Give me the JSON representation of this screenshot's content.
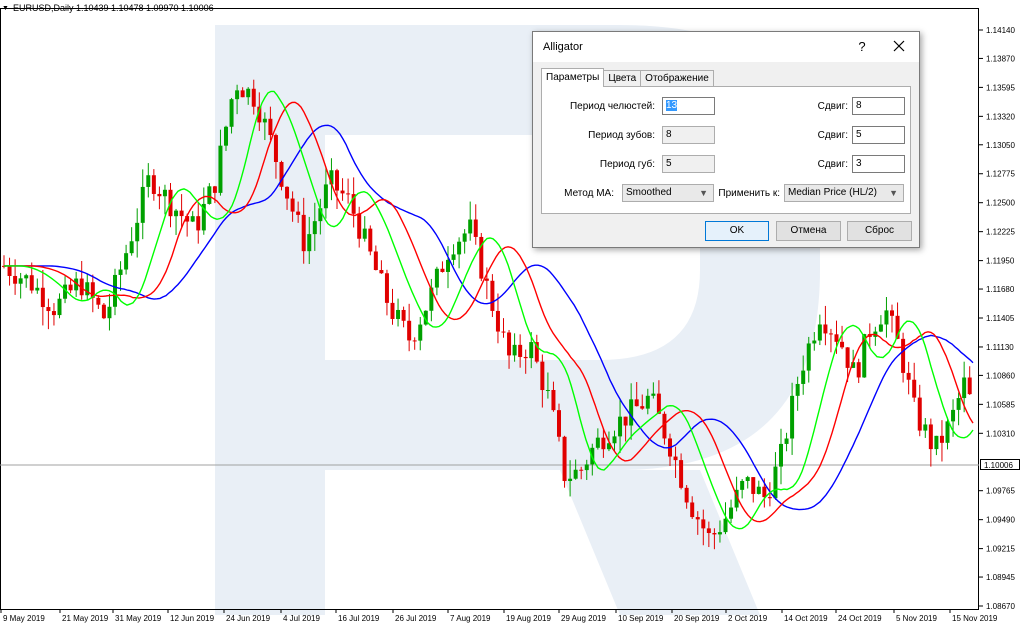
{
  "chart": {
    "symbol_line": "EURUSD,Daily  1.10439 1.10478 1.09970 1.10006",
    "price_levels": [
      "1.14140",
      "1.13870",
      "1.13595",
      "1.13320",
      "1.13050",
      "1.12775",
      "1.12500",
      "1.12225",
      "1.11950",
      "1.11680",
      "1.11405",
      "1.11130",
      "1.10860",
      "1.10585",
      "1.10310",
      "1.10006",
      "1.09765",
      "1.09490",
      "1.09215",
      "1.08945",
      "1.08670"
    ],
    "current_price": "1.10006",
    "date_labels": [
      "9 May 2019",
      "21 May 2019",
      "31 May 2019",
      "12 Jun 2019",
      "24 Jun 2019",
      "4 Jul 2019",
      "16 Jul 2019",
      "26 Jul 2019",
      "7 Aug 2019",
      "19 Aug 2019",
      "29 Aug 2019",
      "10 Sep 2019",
      "20 Sep 2019",
      "2 Oct 2019",
      "14 Oct 2019",
      "24 Oct 2019",
      "5 Nov 2019",
      "15 Nov 2019"
    ],
    "colors": {
      "bull": "#00a000",
      "bear": "#e00000",
      "jaw": "#0000ff",
      "teeth": "#ff0000",
      "lips": "#00ff00",
      "watermark": "#e8eef5"
    }
  },
  "dialog": {
    "title": "Alligator",
    "help": "?",
    "tabs": [
      "Параметры",
      "Цвета",
      "Отображение"
    ],
    "jaw_period_label": "Период челюстей:",
    "jaw_period": "13",
    "teeth_period_label": "Период зубов:",
    "teeth_period": "8",
    "lips_period_label": "Период губ:",
    "lips_period": "5",
    "shift_label": "Сдвиг:",
    "jaw_shift": "8",
    "teeth_shift": "5",
    "lips_shift": "3",
    "ma_method_label": "Метод MA:",
    "ma_method": "Smoothed",
    "apply_to_label": "Применить к:",
    "apply_to": "Median Price (HL/2)",
    "ok": "OK",
    "cancel": "Отмена",
    "reset": "Сброс"
  }
}
